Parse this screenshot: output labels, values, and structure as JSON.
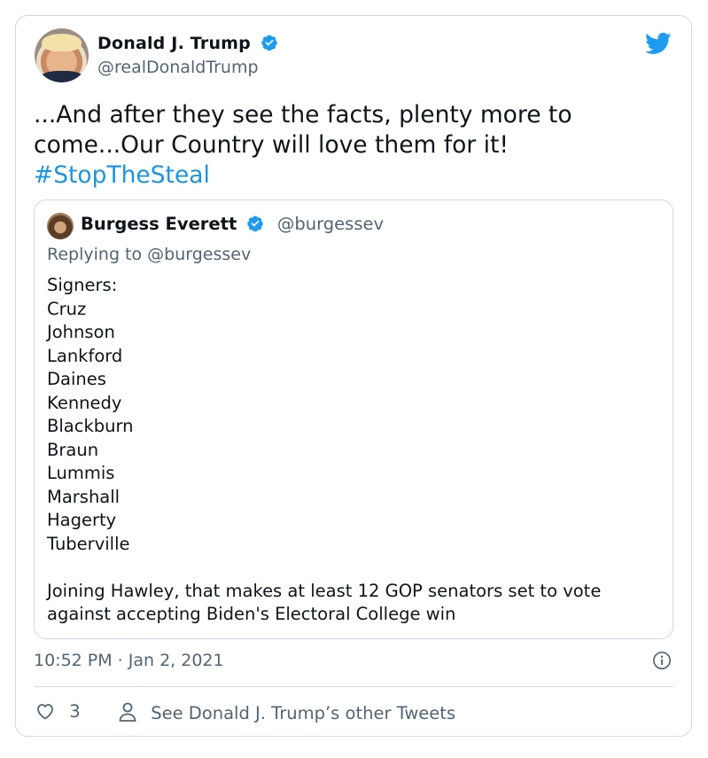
{
  "author": {
    "name": "Donald J. Trump",
    "handle": "@realDonaldTrump"
  },
  "tweet": {
    "text": "...And after they see the facts, plenty more to come...Our Country will love them for it!",
    "hashtag": "#StopTheSteal"
  },
  "quoted": {
    "name": "Burgess Everett",
    "handle": "@burgessev",
    "replying_to": "Replying to @burgessev",
    "lines": [
      "Signers:",
      "Cruz",
      "Johnson",
      "Lankford",
      "Daines",
      "Kennedy",
      "Blackburn",
      "Braun",
      "Lummis",
      "Marshall",
      "Hagerty",
      "Tuberville"
    ],
    "closing": [
      "Joining Hawley, that makes at least 12 GOP senators set to vote",
      "against accepting Biden's Electoral College win"
    ]
  },
  "meta": {
    "timestamp": "10:52 PM · Jan 2, 2021"
  },
  "actions": {
    "like_count": "3",
    "other_tweets": "See Donald J. Trump’s other Tweets"
  },
  "icons": {
    "verified": "verified-badge-icon",
    "brand": "twitter-bird-icon",
    "info": "info-icon",
    "like": "heart-icon",
    "profile": "person-icon"
  },
  "colors": {
    "brand": "#1d9bf0",
    "hashtag": "#1b95e0",
    "secondary_text": "#536471",
    "border": "#cfd9de"
  }
}
